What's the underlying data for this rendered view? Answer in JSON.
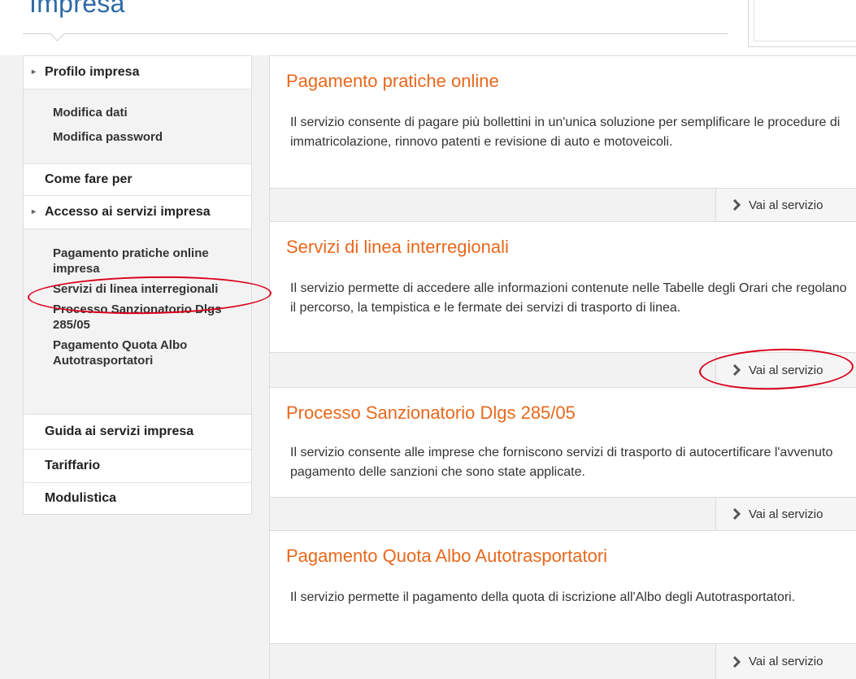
{
  "header": {
    "title": "Impresa"
  },
  "sidebar": {
    "profilo": {
      "label": "Profilo impresa",
      "items": [
        "Modifica dati",
        "Modifica password"
      ]
    },
    "come_fare": "Come fare per",
    "accesso": {
      "label": "Accesso ai servizi impresa",
      "items": [
        "Pagamento pratiche online impresa",
        "Servizi di linea interregionali",
        "Processo Sanzionatorio Dlgs 285/05",
        "Pagamento Quota Albo Autotrasportatori"
      ]
    },
    "guida": "Guida ai servizi impresa",
    "tariffario": "Tariffario",
    "modulistica": "Modulistica"
  },
  "services": [
    {
      "title": "Pagamento pratiche online",
      "description": "Il servizio consente di pagare più bollettini in un'unica soluzione per semplificare le procedure di immatricolazione, rinnovo patenti e revisione di auto e motoveicoli.",
      "action": "Vai al servizio"
    },
    {
      "title": "Servizi di linea interregionali",
      "description": "Il servizio permette di accedere alle informazioni contenute nelle Tabelle degli Orari che regolano il percorso, la tempistica e le fermate dei servizi di trasporto di linea.",
      "action": "Vai al servizio"
    },
    {
      "title": "Processo Sanzionatorio Dlgs 285/05",
      "description": "Il servizio consente alle imprese che forniscono servizi di trasporto di autocertificare l'avvenuto pagamento delle sanzioni che sono state applicate.",
      "action": "Vai al servizio"
    },
    {
      "title": "Pagamento Quota Albo Autotrasportatori",
      "description": "Il servizio permette il pagamento della quota di iscrizione all'Albo degli Autotrasportatori.",
      "action": "Vai al servizio"
    }
  ],
  "colors": {
    "title_blue": "#2d6aa8",
    "service_orange": "#e8681c",
    "annotation_red": "#d9001b"
  }
}
